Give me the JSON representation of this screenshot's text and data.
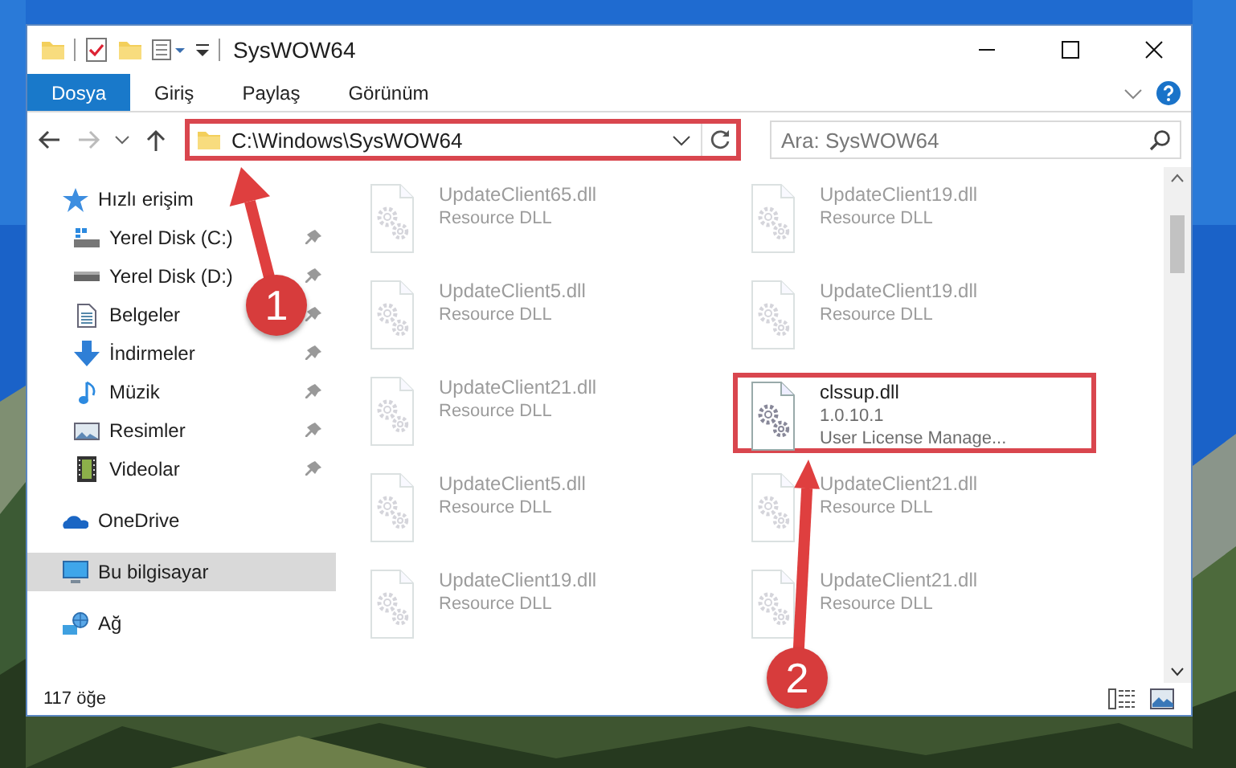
{
  "window": {
    "title": "SysWOW64"
  },
  "ribbon_tabs": [
    {
      "label": "Dosya",
      "selected": true
    },
    {
      "label": "Giriş",
      "selected": false
    },
    {
      "label": "Paylaş",
      "selected": false
    },
    {
      "label": "Görünüm",
      "selected": false
    }
  ],
  "address": {
    "value": "C:\\Windows\\SysWOW64",
    "highlighted": true
  },
  "search": {
    "placeholder": "Ara: SysWOW64"
  },
  "sidebar": {
    "items": [
      {
        "label": "Hızlı erişim",
        "selected": false,
        "children": [
          {
            "label": "Yerel Disk (C:)",
            "pinned": true
          },
          {
            "label": "Yerel Disk (D:)",
            "pinned": true
          },
          {
            "label": "Belgeler",
            "pinned": true
          },
          {
            "label": "İndirmeler",
            "pinned": true
          },
          {
            "label": "Müzik",
            "pinned": true
          },
          {
            "label": "Resimler",
            "pinned": true
          },
          {
            "label": "Videolar",
            "pinned": true
          }
        ]
      },
      {
        "label": "OneDrive",
        "selected": false
      },
      {
        "label": "Bu bilgisayar",
        "selected": true
      },
      {
        "label": "Ağ",
        "selected": false
      }
    ]
  },
  "files": [
    {
      "name": "UpdateClient65.dll",
      "lines": [
        "Resource DLL"
      ],
      "faded": true,
      "highlighted": false
    },
    {
      "name": "UpdateClient19.dll",
      "lines": [
        "Resource DLL"
      ],
      "faded": true,
      "highlighted": false
    },
    {
      "name": "UpdateClient5.dll",
      "lines": [
        "Resource DLL"
      ],
      "faded": true,
      "highlighted": false
    },
    {
      "name": "UpdateClient19.dll",
      "lines": [
        "Resource DLL"
      ],
      "faded": true,
      "highlighted": false
    },
    {
      "name": "UpdateClient21.dll",
      "lines": [
        "Resource DLL"
      ],
      "faded": true,
      "highlighted": false
    },
    {
      "name": "clssup.dll",
      "lines": [
        "1.0.10.1",
        "User License Manage..."
      ],
      "faded": false,
      "highlighted": true
    },
    {
      "name": "UpdateClient5.dll",
      "lines": [
        "Resource DLL"
      ],
      "faded": true,
      "highlighted": false
    },
    {
      "name": "UpdateClient21.dll",
      "lines": [
        "Resource DLL"
      ],
      "faded": true,
      "highlighted": false
    },
    {
      "name": "UpdateClient19.dll",
      "lines": [
        "Resource DLL"
      ],
      "faded": true,
      "highlighted": false
    },
    {
      "name": "UpdateClient21.dll",
      "lines": [
        "Resource DLL"
      ],
      "faded": true,
      "highlighted": false
    }
  ],
  "status_bar": {
    "count": "117 öğe"
  },
  "annotations": [
    {
      "label": "1"
    },
    {
      "label": "2"
    }
  ]
}
